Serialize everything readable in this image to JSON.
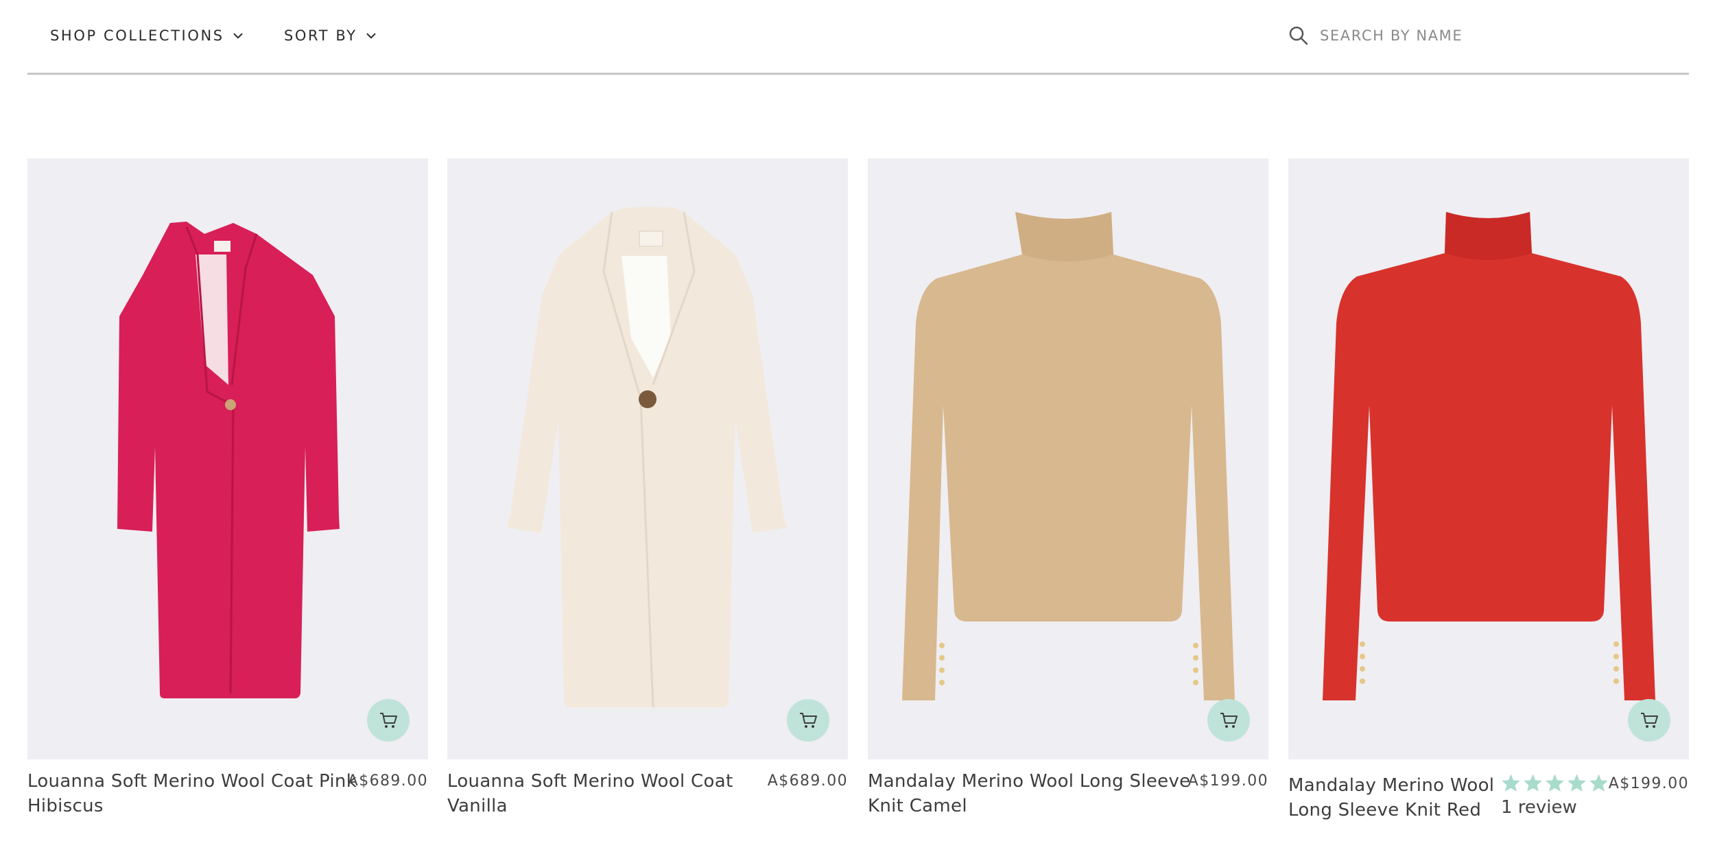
{
  "filters": {
    "shop_collections": "SHOP COLLECTIONS",
    "sort_by": "SORT BY"
  },
  "search": {
    "placeholder": "SEARCH BY NAME",
    "value": ""
  },
  "products": [
    {
      "title_line1": "Louanna Soft Merino Wool Coat Pink",
      "title_line2": "Hibiscus",
      "price": "A$689.00",
      "garment_color": "#d81f57"
    },
    {
      "title_line1": "Louanna Soft Merino Wool Coat",
      "title_line2": "Vanilla",
      "price": "A$689.00",
      "garment_color": "#f2e9dc"
    },
    {
      "title_line1": "Mandalay Merino Wool Long Sleeve",
      "title_line2": "Knit Camel",
      "price": "A$199.00",
      "garment_color": "#d8b88f"
    },
    {
      "title_line1": "Mandalay Merino Wool",
      "title_line2": "Long Sleeve Knit Red",
      "price": "A$199.00",
      "rating": 5,
      "review_count": "1 review",
      "garment_color": "#d8322d"
    }
  ],
  "colors": {
    "image_bg": "#efeef2",
    "cart_button": "#bfe3d8",
    "star": "#a9dbcc",
    "divider": "#c6c6c6"
  },
  "icons": {
    "search": "search-icon",
    "chevron": "chevron-down-icon",
    "cart": "cart-icon",
    "star": "star-icon"
  }
}
